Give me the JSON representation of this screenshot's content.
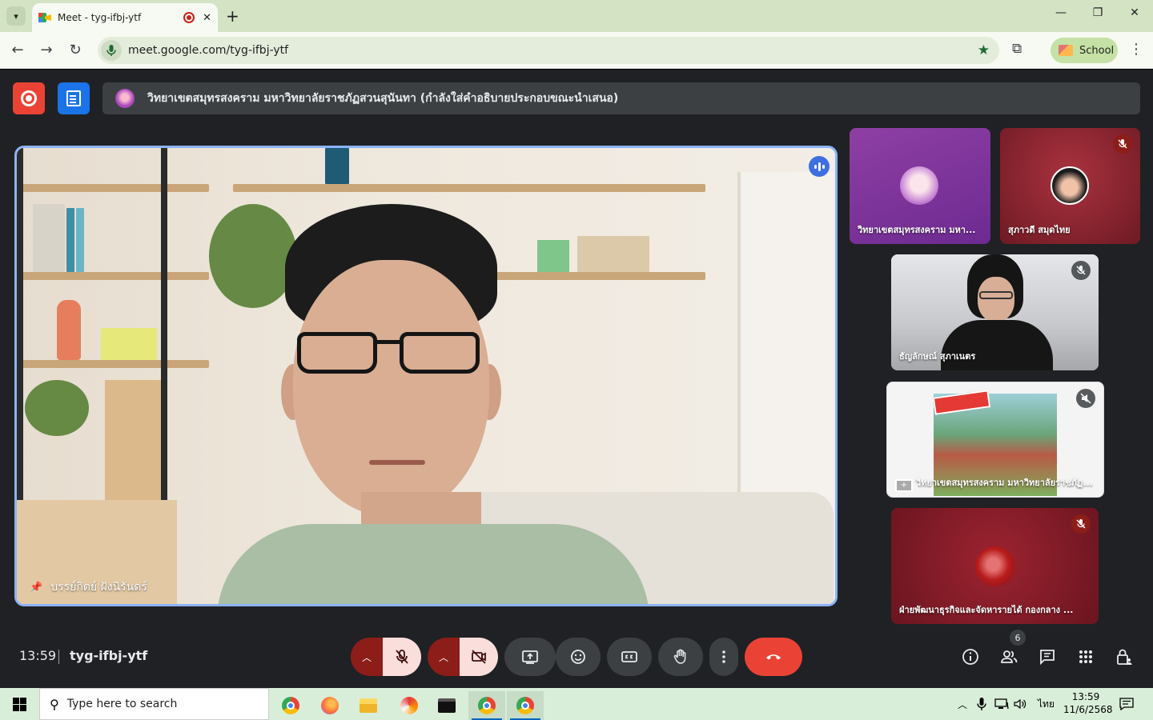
{
  "browser": {
    "tab_title": "Meet - tyg-ifbj-ytf",
    "tab_close": "✕",
    "new_tab": "+",
    "url": "meet.google.com/tyg-ifbj-ytf",
    "profile_label": "School",
    "window_min": "—",
    "window_max": "❐",
    "window_close": "✕"
  },
  "meet": {
    "caption": "วิทยาเขตสมุทรสงคราม มหาวิทยาลัยราชภัฏสวนสุนันทา (กำลังใส่คำอธิบายประกอบขณะนำเสนอ)",
    "main_speaker": "บรรย์กิตย์ ฝังนิรันดร์",
    "tiles": [
      {
        "name": "วิทยาเขตสมุทรสงคราม มหา..."
      },
      {
        "name": "สุภาวดี สมุดไทย"
      },
      {
        "name": "ธัญลักษณ์ สุภาเนตร"
      },
      {
        "name": "วิทยาเขตสมุทรสงคราม มหาวิทยาลัยราชภัฏ..."
      },
      {
        "name": "ฝ่ายพัฒนาธุรกิจและจัดหารายได้ กองกลาง ..."
      }
    ],
    "clock": "13:59",
    "meeting_code": "tyg-ifbj-ytf",
    "people_count": "6"
  },
  "taskbar": {
    "search_placeholder": "Type here to search",
    "language": "ไทย",
    "time": "13:59",
    "date": "11/6/2568"
  },
  "colors": {
    "meet_bg": "#202124",
    "end_call": "#ea4335",
    "active_speaker_border": "#8ab4f8",
    "muted_control": "#f9dedc"
  }
}
